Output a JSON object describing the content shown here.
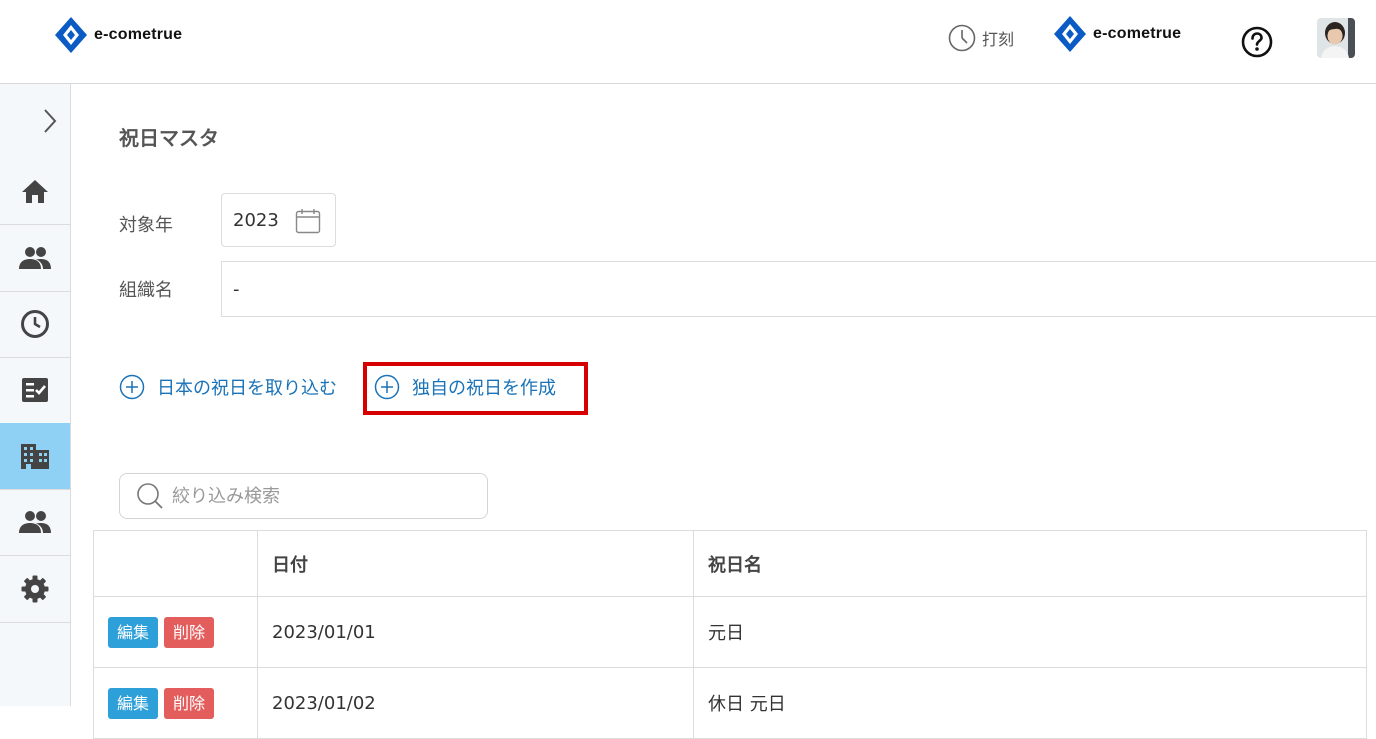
{
  "header": {
    "logo_text": "e-cometrue",
    "clock_label": "打刻",
    "company_logo_text": "e-cometrue"
  },
  "sidebar": {
    "items": [
      {
        "icon": "home-icon"
      },
      {
        "icon": "people-icon"
      },
      {
        "icon": "clock-icon"
      },
      {
        "icon": "checklist-icon"
      },
      {
        "icon": "building-icon",
        "active": true
      },
      {
        "icon": "group-icon"
      },
      {
        "icon": "gear-icon"
      }
    ]
  },
  "page": {
    "title": "祝日マスタ",
    "year_label": "対象年",
    "year_value": "2023",
    "org_label": "組織名",
    "org_value": "-",
    "import_label": "日本の祝日を取り込む",
    "create_label": "独自の祝日を作成",
    "search_placeholder": "絞り込み検索"
  },
  "table": {
    "headers": [
      "",
      "日付",
      "祝日名"
    ],
    "edit_label": "編集",
    "delete_label": "削除",
    "rows": [
      {
        "date": "2023/01/01",
        "name": "元日"
      },
      {
        "date": "2023/01/02",
        "name": "休日 元日"
      }
    ]
  },
  "colors": {
    "accent": "#1a73b8",
    "active_nav": "#8fd0f5",
    "edit": "#2d9fd9",
    "delete": "#e35d5d",
    "highlight": "#d60000"
  }
}
